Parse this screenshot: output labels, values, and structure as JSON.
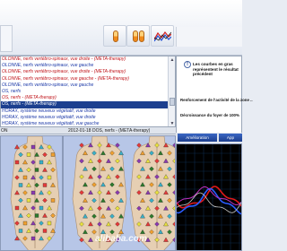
{
  "list": {
    "items": [
      {
        "text": "OLONNE, nerfs vertébro-spinaux, vue droite - (META-therapy)",
        "color": "red"
      },
      {
        "text": "OLONNE, nerfs vertébro-spinaux, vue gauche",
        "color": "blue"
      },
      {
        "text": "OLONNE, nerfs vertébro-spinaux, vue droite - (META-therapy)",
        "color": "red"
      },
      {
        "text": "OLONNE, nerfs vertébro-spinaux, vue gauche - (META-therapy)",
        "color": "red"
      },
      {
        "text": "OLONNE, nerfs vertébro-spinaux, vue gauche",
        "color": "blue"
      },
      {
        "text": "OS, nerfs",
        "color": "blue"
      },
      {
        "text": "OS, nerfs - (META-therapy)",
        "color": "red"
      },
      {
        "text": "OS, nerfs - (META-therapy)",
        "color": "sel"
      },
      {
        "text": "HORAX, système neuveux végétatif, vue droite",
        "color": "blue"
      },
      {
        "text": "HORAX, système neuveux végétatif, vue droite",
        "color": "blue"
      },
      {
        "text": "HORAX, système neuveux végétatif, vue gauche",
        "color": "blue"
      }
    ]
  },
  "status": {
    "left": "ON",
    "right": "2012-01-18  DOS, nerfs - (META-therapy)"
  },
  "info": {
    "warning_text": "Les courbes en gras représentent le résultat précédent",
    "line1": "Renforcement de l'activité de la zone ..",
    "line2": "Décroissance du foyer de 100%"
  },
  "buttons": {
    "amelioration": "Amélioration",
    "second": "App"
  },
  "watermark": "alibaba.com",
  "colors": {
    "selection": "#1c3f8f",
    "list_red": "#c0141a",
    "list_blue": "#1c39a8",
    "chart_bg": "#000000"
  }
}
